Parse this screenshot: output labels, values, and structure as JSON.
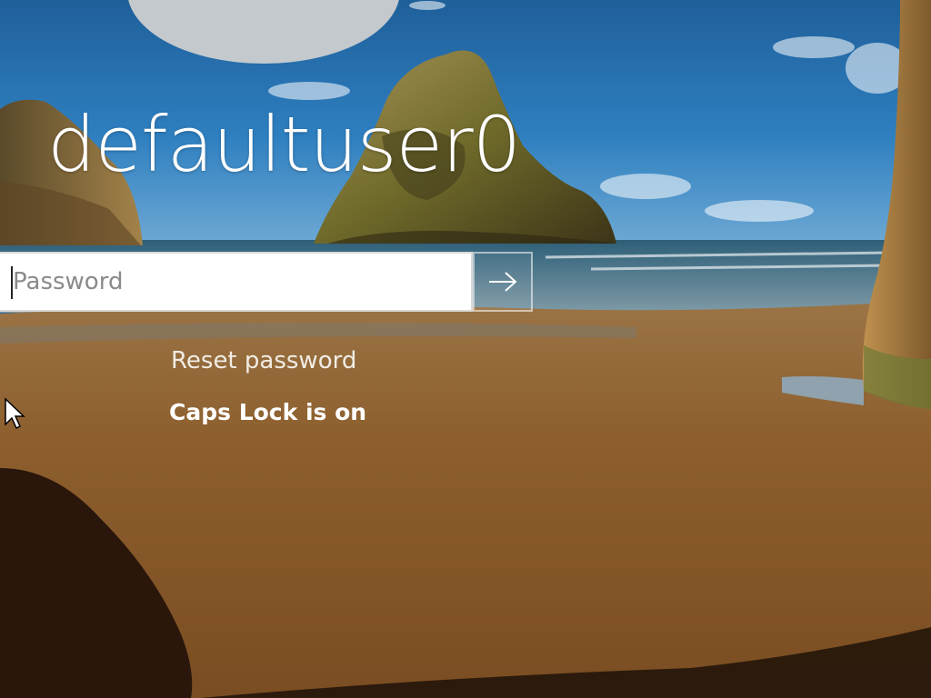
{
  "user": {
    "name": "defaultuser0"
  },
  "login": {
    "password_placeholder": "Password",
    "password_value": "",
    "submit_icon": "arrow-right-icon",
    "reset_link_label": "Reset password",
    "caps_lock_message": "Caps Lock is on"
  },
  "background": {
    "scene": "beach-rocks-wallpaper",
    "colors": {
      "sky": "#1d6aa6",
      "sand": "#8a5a28",
      "rock": "#6e5a2c"
    }
  },
  "pointer": {
    "icon": "mouse-cursor-icon"
  }
}
